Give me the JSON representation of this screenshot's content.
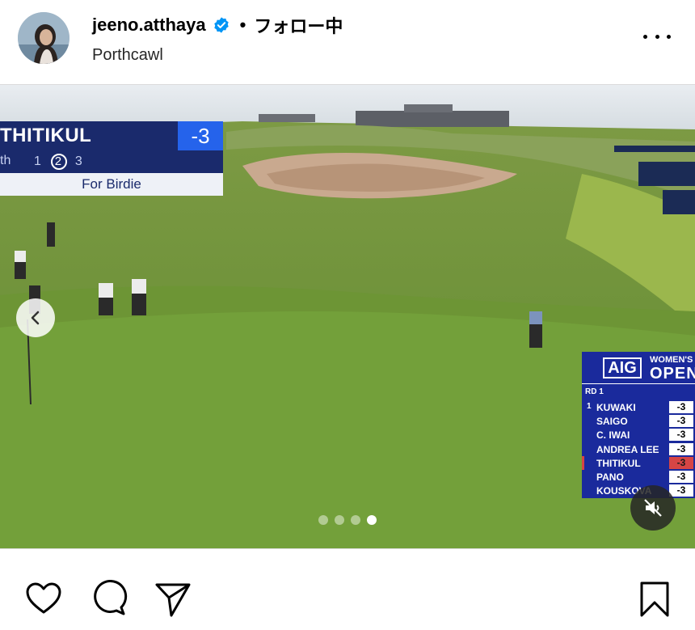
{
  "post": {
    "username": "jeeno.atthaya",
    "separator": "•",
    "follow_status": "フォロー中",
    "location": "Porthcawl"
  },
  "score_bug": {
    "player": "THITIKUL",
    "score": "-3",
    "hole": "th",
    "shots_before": "1",
    "shot_current": "2",
    "shots_after": "3",
    "caption": "For Birdie"
  },
  "leaderboard": {
    "brand": "AIG",
    "event_top": "WOMEN'S",
    "event_bottom": "OPEN",
    "round": "RD 1",
    "rows": [
      {
        "pos": "1",
        "name": "KUWAKI",
        "score": "-3"
      },
      {
        "pos": "",
        "name": "SAIGO",
        "score": "-3"
      },
      {
        "pos": "",
        "name": "C. IWAI",
        "score": "-3"
      },
      {
        "pos": "",
        "name": "ANDREA LEE",
        "score": "-3"
      },
      {
        "pos": "",
        "name": "THITIKUL",
        "score": "-3"
      },
      {
        "pos": "",
        "name": "PANO",
        "score": "-3"
      },
      {
        "pos": "",
        "name": "KOUSKOVA",
        "score": "-3"
      }
    ],
    "highlight_row": 4
  },
  "carousel": {
    "count": 4,
    "active": 3
  },
  "icons": {
    "verified": "verified-badge-icon",
    "more": "more-options-icon",
    "prev": "chevron-left-icon",
    "mute": "speaker-muted-icon",
    "like": "heart-icon",
    "comment": "comment-bubble-icon",
    "share": "paper-plane-icon",
    "save": "bookmark-icon"
  },
  "colors": {
    "verified": "#0095f6",
    "broadcast_navy": "#1a2a6c",
    "broadcast_blue": "#2563eb",
    "leaderboard_bg": "#1a2a9c",
    "highlight_red": "#d64545"
  }
}
